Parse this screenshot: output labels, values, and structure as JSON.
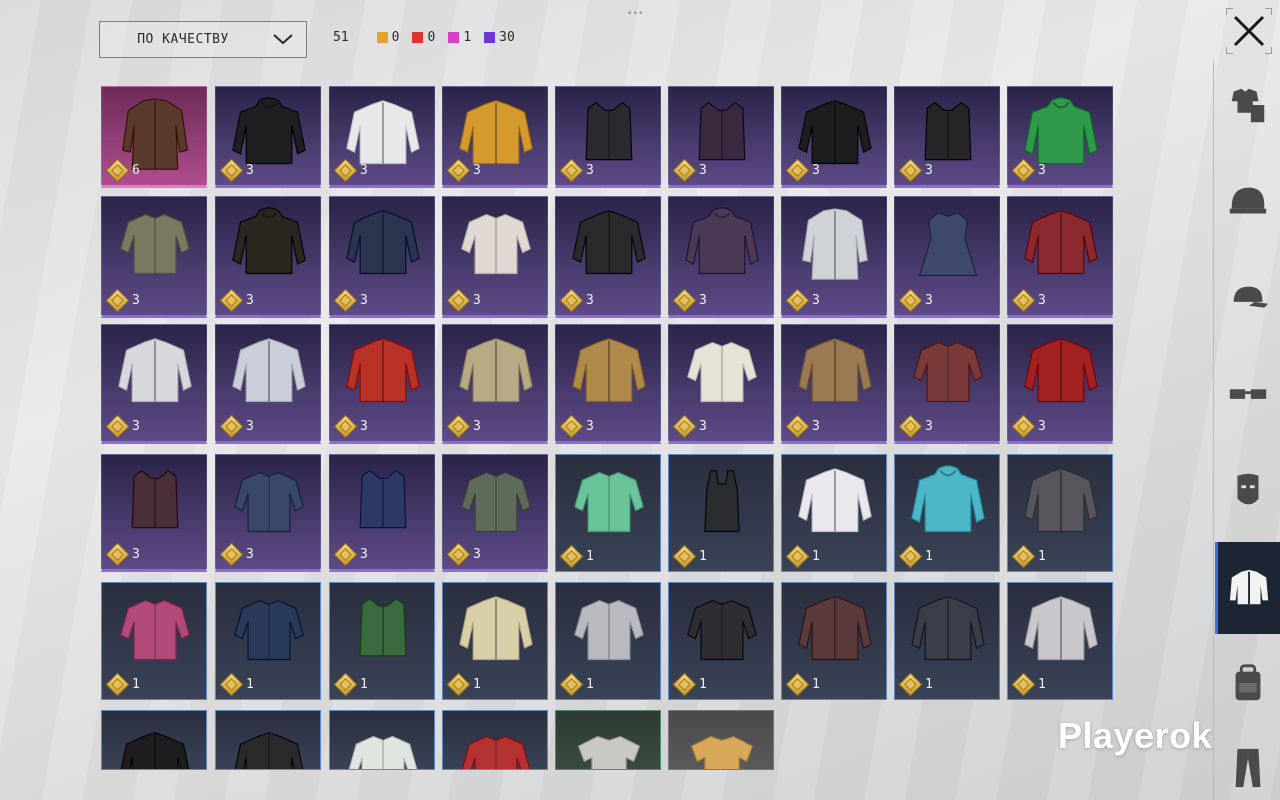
{
  "sort": {
    "label": "ПО КАЧЕСТВУ"
  },
  "counts": {
    "total": "51",
    "items": [
      {
        "color": "#e8a12a",
        "value": "0"
      },
      {
        "color": "#e03232",
        "value": "0"
      },
      {
        "color": "#d93fc4",
        "value": "1"
      },
      {
        "color": "#6a36d8",
        "value": "30"
      }
    ]
  },
  "close_icon": "close-icon",
  "watermark": "Playerok",
  "sidebar": [
    {
      "name": "outfit-icon",
      "active": false
    },
    {
      "name": "helmet-icon",
      "active": false
    },
    {
      "name": "cap-icon",
      "active": false
    },
    {
      "name": "glasses-icon",
      "active": false
    },
    {
      "name": "mask-icon",
      "active": false
    },
    {
      "name": "jacket-icon",
      "active": true
    },
    {
      "name": "backpack-icon",
      "active": false
    },
    {
      "name": "pants-icon",
      "active": false
    }
  ],
  "items": [
    {
      "rarity": "pink",
      "count": "6",
      "color": "#5a3a2a",
      "kind": "coat"
    },
    {
      "rarity": "purple",
      "count": "3",
      "color": "#1f1f22",
      "kind": "hoodie"
    },
    {
      "rarity": "purple",
      "count": "3",
      "color": "#e8e8ea",
      "kind": "jacket"
    },
    {
      "rarity": "purple",
      "count": "3",
      "color": "#d49a2e",
      "kind": "jacket"
    },
    {
      "rarity": "purple",
      "count": "3",
      "color": "#2a2a30",
      "kind": "vest"
    },
    {
      "rarity": "purple",
      "count": "3",
      "color": "#3a2a40",
      "kind": "vest"
    },
    {
      "rarity": "purple",
      "count": "3",
      "color": "#1d1d20",
      "kind": "jacket"
    },
    {
      "rarity": "purple",
      "count": "3",
      "color": "#262628",
      "kind": "vest"
    },
    {
      "rarity": "purple",
      "count": "3",
      "color": "#2f9a4a",
      "kind": "hoodie"
    },
    {
      "rarity": "purple",
      "count": "3",
      "color": "#7a7a60",
      "kind": "shirt"
    },
    {
      "rarity": "purple",
      "count": "3",
      "color": "#2a2620",
      "kind": "hoodie"
    },
    {
      "rarity": "purple",
      "count": "3",
      "color": "#2c3550",
      "kind": "jacket"
    },
    {
      "rarity": "purple",
      "count": "3",
      "color": "#e0d8d2",
      "kind": "shirt"
    },
    {
      "rarity": "purple",
      "count": "3",
      "color": "#2a2a2c",
      "kind": "jacket"
    },
    {
      "rarity": "purple",
      "count": "3",
      "color": "#4a3a55",
      "kind": "hoodie"
    },
    {
      "rarity": "purple",
      "count": "3",
      "color": "#cfd3d8",
      "kind": "coat"
    },
    {
      "rarity": "purple",
      "count": "3",
      "color": "#3f4a6a",
      "kind": "dress"
    },
    {
      "rarity": "purple",
      "count": "3",
      "color": "#8a2a2e",
      "kind": "jacket"
    },
    {
      "rarity": "purple",
      "count": "3",
      "color": "#d8d8dc",
      "kind": "jacket"
    },
    {
      "rarity": "purple",
      "count": "3",
      "color": "#c9ced8",
      "kind": "jacket"
    },
    {
      "rarity": "purple",
      "count": "3",
      "color": "#b83228",
      "kind": "jacket"
    },
    {
      "rarity": "purple",
      "count": "3",
      "color": "#b8aa84",
      "kind": "jacket"
    },
    {
      "rarity": "purple",
      "count": "3",
      "color": "#b08a4a",
      "kind": "jacket"
    },
    {
      "rarity": "purple",
      "count": "3",
      "color": "#e6e2d6",
      "kind": "shirt"
    },
    {
      "rarity": "purple",
      "count": "3",
      "color": "#9a7a52",
      "kind": "jacket"
    },
    {
      "rarity": "purple",
      "count": "3",
      "color": "#7a3a3a",
      "kind": "shirt"
    },
    {
      "rarity": "purple",
      "count": "3",
      "color": "#a22222",
      "kind": "jacket"
    },
    {
      "rarity": "purple",
      "count": "3",
      "color": "#4a2e38",
      "kind": "vest"
    },
    {
      "rarity": "purple",
      "count": "3",
      "color": "#3a4868",
      "kind": "shirt"
    },
    {
      "rarity": "purple",
      "count": "3",
      "color": "#2e3a66",
      "kind": "vest"
    },
    {
      "rarity": "purple",
      "count": "3",
      "color": "#5e6a5a",
      "kind": "shirt"
    },
    {
      "rarity": "blue",
      "count": "1",
      "color": "#6ac49a",
      "kind": "shirt"
    },
    {
      "rarity": "blue",
      "count": "1",
      "color": "#2a2c30",
      "kind": "tank"
    },
    {
      "rarity": "blue",
      "count": "1",
      "color": "#e8e8ee",
      "kind": "jacket"
    },
    {
      "rarity": "blue",
      "count": "1",
      "color": "#4ab6c8",
      "kind": "hoodie"
    },
    {
      "rarity": "blue",
      "count": "1",
      "color": "#56565c",
      "kind": "jacket"
    },
    {
      "rarity": "blue",
      "count": "1",
      "color": "#b24a7a",
      "kind": "shirt"
    },
    {
      "rarity": "blue",
      "count": "1",
      "color": "#2a3a5a",
      "kind": "shirt"
    },
    {
      "rarity": "blue",
      "count": "1",
      "color": "#3a6a3e",
      "kind": "vest"
    },
    {
      "rarity": "blue",
      "count": "1",
      "color": "#d8cfa8",
      "kind": "jacket"
    },
    {
      "rarity": "blue",
      "count": "1",
      "color": "#b8bac0",
      "kind": "shirt"
    },
    {
      "rarity": "blue",
      "count": "1",
      "color": "#2e2e32",
      "kind": "shirt"
    },
    {
      "rarity": "blue",
      "count": "1",
      "color": "#5a3a3a",
      "kind": "jacket"
    },
    {
      "rarity": "blue",
      "count": "1",
      "color": "#3a3e48",
      "kind": "jacket"
    },
    {
      "rarity": "blue",
      "count": "1",
      "color": "#c8c8cc",
      "kind": "jacket"
    },
    {
      "rarity": "blue",
      "count": "",
      "color": "#1e1e20",
      "kind": "jacket"
    },
    {
      "rarity": "blue",
      "count": "",
      "color": "#2a2a2c",
      "kind": "jacket"
    },
    {
      "rarity": "blue",
      "count": "",
      "color": "#dfe6e0",
      "kind": "shirt"
    },
    {
      "rarity": "blue",
      "count": "",
      "color": "#b43232",
      "kind": "shirt"
    },
    {
      "rarity": "green",
      "count": "",
      "color": "#c9c9c4",
      "kind": "tshirt"
    },
    {
      "rarity": "gray",
      "count": "",
      "color": "#d8a85a",
      "kind": "tshirt"
    }
  ]
}
